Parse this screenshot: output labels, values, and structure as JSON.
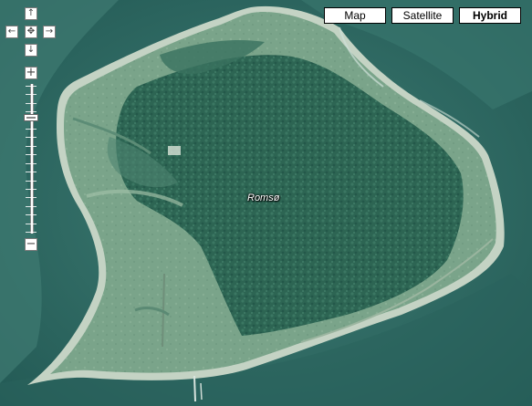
{
  "map": {
    "place_label": "Romsø",
    "view_mode": "Hybrid"
  },
  "map_types": [
    {
      "label": "Map",
      "active": false
    },
    {
      "label": "Satellite",
      "active": false
    },
    {
      "label": "Hybrid",
      "active": true
    }
  ],
  "controls": {
    "pan_up_icon": "arrow-up-icon",
    "pan_left_icon": "arrow-left-icon",
    "pan_center_icon": "recenter-icon",
    "pan_right_icon": "arrow-right-icon",
    "pan_down_icon": "arrow-down-icon",
    "zoom_in_label": "+",
    "zoom_out_label": "−",
    "zoom_level_fraction": 0.22
  },
  "colors": {
    "sea": "#2f6e66",
    "shallow_sea": "#4f8a80",
    "grassland": "#7ea78d",
    "forest": "#2f6a58",
    "beach": "#c9d6c8"
  }
}
